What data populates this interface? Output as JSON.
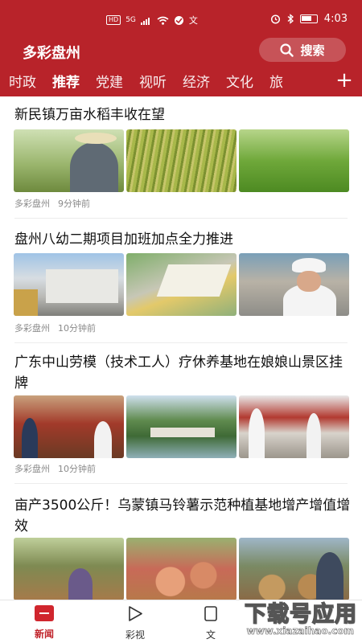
{
  "status_bar": {
    "hd": "HD",
    "network": "5G",
    "time": "4:03",
    "icons": [
      "hd-badge",
      "signal-icon",
      "wifi-icon",
      "vpn-icon",
      "language-icon",
      "alarm-icon",
      "bluetooth-icon",
      "battery-icon"
    ]
  },
  "header": {
    "title": "多彩盘州",
    "search_label": "搜索"
  },
  "tabs": [
    "时政",
    "推荐",
    "党建",
    "视听",
    "经济",
    "文化",
    "旅"
  ],
  "active_tab": "推荐",
  "feed": [
    {
      "title": "新民镇万亩水稻丰收在望",
      "source": "多彩盘州",
      "time": "9分钟前"
    },
    {
      "title": "盘州八幼二期项目加班加点全力推进",
      "source": "多彩盘州",
      "time": "10分钟前"
    },
    {
      "title": "广东中山劳模（技术工人）疗休养基地在娘娘山景区挂牌",
      "source": "多彩盘州",
      "time": "10分钟前"
    },
    {
      "title": "亩产3500公斤！乌蒙镇马铃薯示范种植基地增产增值增效",
      "source": "",
      "time": ""
    }
  ],
  "bottom_nav": [
    {
      "label": "新闻",
      "icon": "news-icon",
      "active": true
    },
    {
      "label": "彩视",
      "icon": "play-icon",
      "active": false
    },
    {
      "label": "文",
      "icon": "document-icon",
      "active": false
    }
  ],
  "watermark": {
    "text": "下载号应用",
    "url": "www.xiazaihao.com"
  },
  "colors": {
    "brand": "#b8232a",
    "active_nav": "#c0232a"
  }
}
